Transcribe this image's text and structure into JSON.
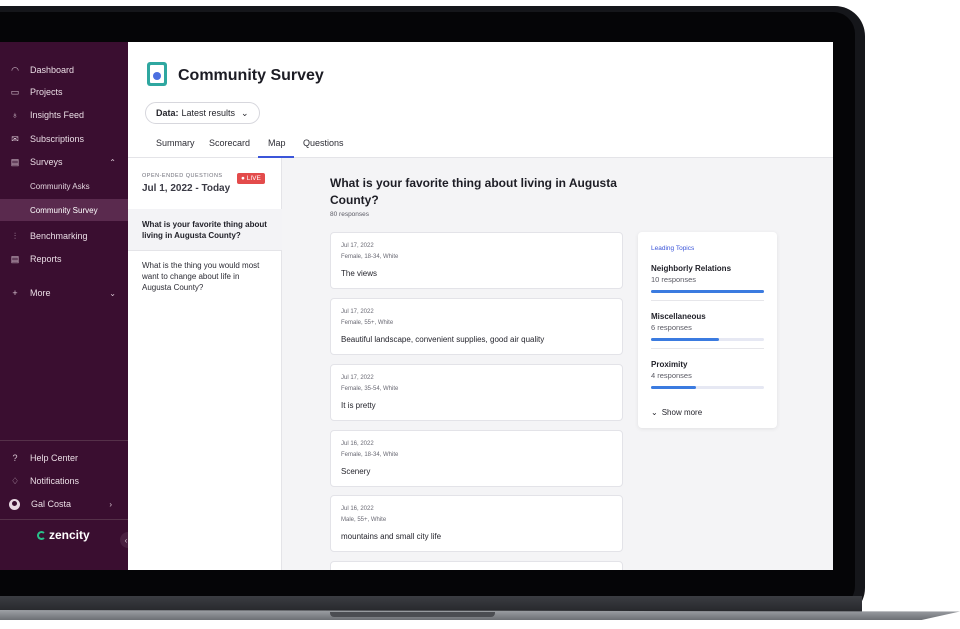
{
  "sidebar": {
    "items": [
      {
        "label": "Dashboard",
        "icon": "dashboard-icon",
        "glyph": "◠"
      },
      {
        "label": "Projects",
        "icon": "folder-icon",
        "glyph": "▭"
      },
      {
        "label": "Insights Feed",
        "icon": "lightbulb-icon",
        "glyph": "♁"
      },
      {
        "label": "Subscriptions",
        "icon": "mail-icon",
        "glyph": "✉"
      },
      {
        "label": "Surveys",
        "icon": "survey-icon",
        "glyph": "▤",
        "chevron": "⌃"
      }
    ],
    "sub_items": [
      {
        "label": "Community Asks"
      },
      {
        "label": "Community Survey"
      }
    ],
    "items2": [
      {
        "label": "Benchmarking",
        "icon": "benchmark-icon",
        "glyph": "⫶"
      },
      {
        "label": "Reports",
        "icon": "report-icon",
        "glyph": "▤"
      },
      {
        "label": "More",
        "icon": "plus-icon",
        "glyph": "+",
        "chevron": "⌄"
      }
    ],
    "bottom": [
      {
        "label": "Help Center",
        "icon": "help-icon",
        "glyph": "?"
      },
      {
        "label": "Notifications",
        "icon": "bell-icon",
        "glyph": "♢"
      }
    ],
    "user": {
      "name": "Gal Costa",
      "chevron": "›"
    },
    "logo": "zencity"
  },
  "header": {
    "title": "Community Survey",
    "data_label": "Data:",
    "data_value": "Latest results",
    "tabs": [
      "Summary",
      "Scorecard",
      "Map",
      "Questions"
    ],
    "active_tab": "Map"
  },
  "questions_panel": {
    "eyebrow": "OPEN-ENDED QUESTIONS",
    "date_range": "Jul 1, 2022 - Today",
    "live_badge": "● LIVE",
    "questions": [
      "What is your favorite thing about living in Augusta County?",
      "What is the thing you would most want to change about life in Augusta County?"
    ]
  },
  "content": {
    "question": "What is your favorite thing about living in Augusta County?",
    "responses_count": "80 responses",
    "responses": [
      {
        "date": "Jul 17, 2022",
        "meta": "Female, 18-34, White",
        "text": "The views"
      },
      {
        "date": "Jul 17, 2022",
        "meta": "Female, 55+, White",
        "text": "Beautiful landscape, convenient supplies, good air quality"
      },
      {
        "date": "Jul 17, 2022",
        "meta": "Female, 35-54, White",
        "text": "It is pretty"
      },
      {
        "date": "Jul 16, 2022",
        "meta": "Female, 18-34, White",
        "text": "Scenery"
      },
      {
        "date": "Jul 16, 2022",
        "meta": "Male, 55+, White",
        "text": "mountains and small city life"
      }
    ]
  },
  "leading_topics": {
    "header": "Leading Topics",
    "topics": [
      {
        "name": "Neighborly Relations",
        "count": "10 responses",
        "fill": 1.0
      },
      {
        "name": "Miscellaneous",
        "count": "6 responses",
        "fill": 0.6
      },
      {
        "name": "Proximity",
        "count": "4 responses",
        "fill": 0.4
      }
    ],
    "show_more": "Show more"
  },
  "colors": {
    "sidebar_bg": "#3a0e30",
    "accent": "#3b55d9",
    "live": "#e34b4b",
    "bar": "#3b7be0"
  }
}
